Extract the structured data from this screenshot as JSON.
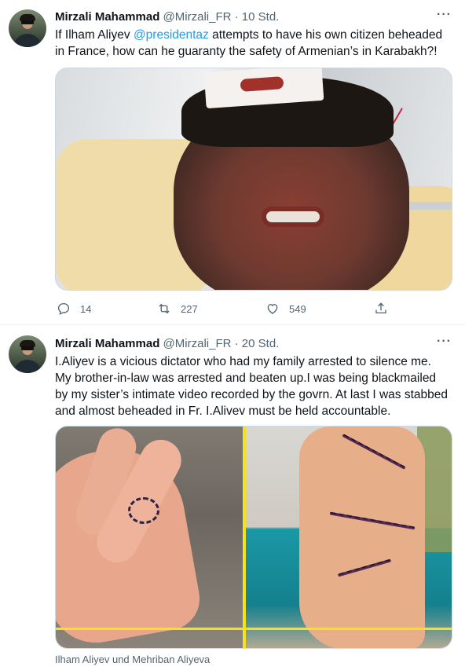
{
  "tweets": [
    {
      "author_name": "Mirzali Mahammad",
      "handle": "@Mirzali_FR",
      "separator": "·",
      "time": "10 Std.",
      "more": "···",
      "text_before": "If Ilham Aliyev ",
      "mention": "@presidentaz",
      "text_after": " attempts to have his own citizen beheaded in France, how can he guaranty the safety of Armenian’s in Karabakh?!",
      "actions": {
        "replies": "14",
        "retweets": "227",
        "likes": "549"
      }
    },
    {
      "author_name": "Mirzali Mahammad",
      "handle": "@Mirzali_FR",
      "separator": "·",
      "time": "20 Std.",
      "more": "···",
      "text": "I.Aliyev is a vicious dictator who had my family arrested to silence me. My brother-in-law was arrested and beaten up.I was being blackmailed by my sister’s intimate video  recorded by the govrn. At last I was stabbed and almost beheaded in Fr. I.Alivev must be held accountable.",
      "media_caption": "Ilham Aliyev und Mehriban Aliyeva"
    }
  ],
  "colors": {
    "link": "#1d9bf0",
    "muted": "#536471",
    "text": "#0f1419",
    "border": "#cfd9de"
  },
  "icons": [
    "reply-icon",
    "retweet-icon",
    "like-icon",
    "share-icon",
    "more-icon"
  ]
}
